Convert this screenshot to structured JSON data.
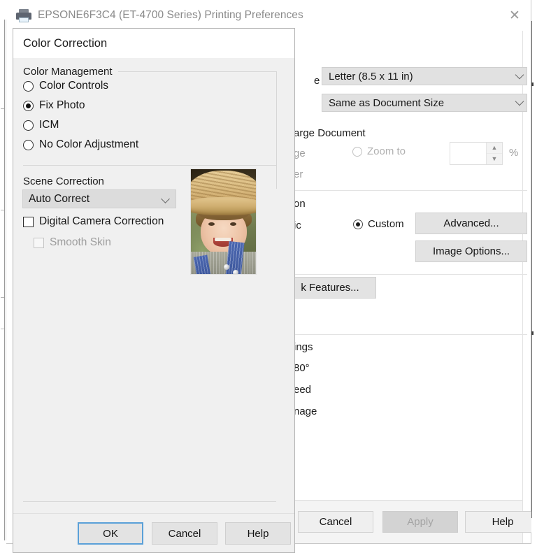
{
  "window": {
    "title": "EPSONE6F3C4 (ET-4700 Series) Printing Preferences",
    "printer_icon": "printer-icon",
    "close_icon": "✕",
    "fields": {
      "document_size_label": "e",
      "document_size_value": "Letter (8.5 x 11 in)",
      "output_paper_value": "Same as Document Size",
      "enlarge_document_label": "arge Document",
      "fit_to_page_label": "ge",
      "other_label": "er",
      "zoom_to_label": "Zoom to",
      "zoom_to_value": "",
      "percent_label": "%",
      "correction_label": "on",
      "automatic_label": "ic",
      "custom_label": "Custom",
      "advanced_button": "Advanced...",
      "image_options_button": "Image Options...",
      "ink_features_button": "k Features...",
      "settings_label": "ings",
      "rotate_label": "80°",
      "speed_label": "eed",
      "mirror_label": "nage"
    },
    "footer_buttons": {
      "cancel": "Cancel",
      "apply": "Apply",
      "help": "Help"
    }
  },
  "dialog": {
    "title": "Color Correction",
    "group_title": "Color Management",
    "color_management_options": [
      {
        "label": "Color Controls",
        "checked": false
      },
      {
        "label": "Fix Photo",
        "checked": true
      },
      {
        "label": "ICM",
        "checked": false
      },
      {
        "label": "No Color Adjustment",
        "checked": false
      }
    ],
    "scene_correction_label": "Scene Correction",
    "scene_correction_value": "Auto Correct",
    "digital_camera_correction": {
      "label": "Digital Camera Correction",
      "checked": false
    },
    "smooth_skin": {
      "label": "Smooth Skin",
      "checked": false,
      "disabled": true
    },
    "preview_image_alt": "photo-preview-child-in-straw-hat",
    "buttons": {
      "ok": "OK",
      "cancel": "Cancel",
      "help": "Help"
    }
  },
  "colors": {
    "dialog_bg": "#f0f0f0",
    "window_bg": "#ffffff",
    "focus_border": "#5aa0d8",
    "title_text": "#8a8a8a",
    "disabled_text": "#a4a4a4"
  }
}
